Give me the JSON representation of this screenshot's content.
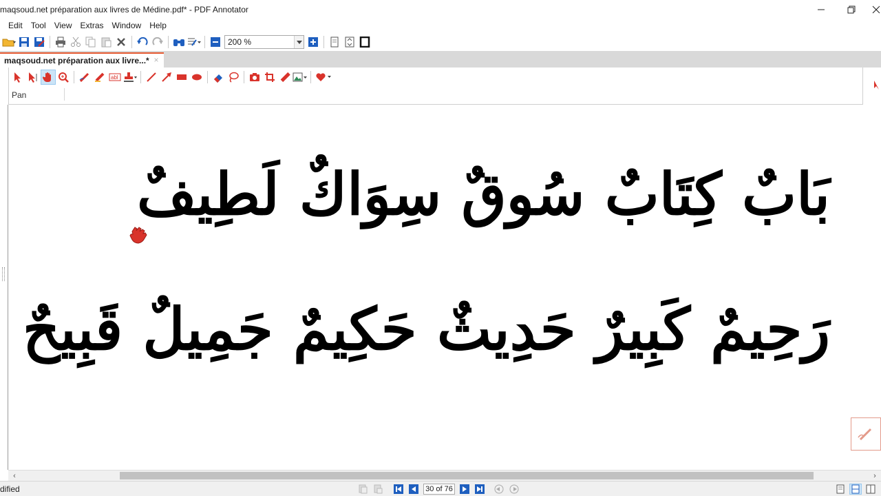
{
  "window": {
    "title": "maqsoud.net préparation aux livres de Médine.pdf* - PDF Annotator",
    "minimize_glyph": "—",
    "restore_glyph": "❐",
    "close_glyph": "✕"
  },
  "menu": {
    "items": [
      "Edit",
      "Tool",
      "View",
      "Extras",
      "Window",
      "Help"
    ]
  },
  "toolbar": {
    "icons": [
      "open-folder-icon",
      "save-icon",
      "save-as-icon",
      "print-icon",
      "cut-icon",
      "copy-icon",
      "paste-icon",
      "delete-icon",
      "undo-icon",
      "redo-icon",
      "find-icon",
      "page-layout-icon",
      "zoom-out-icon",
      "zoom-in-icon",
      "single-page-icon",
      "fit-page-icon",
      "fullscreen-icon"
    ],
    "zoom_value": "200 %"
  },
  "tabs": [
    {
      "label": "maqsoud.net préparation aux livre...*",
      "close": "×"
    }
  ],
  "annotation_toolbar": {
    "tools": [
      "select-icon",
      "select-text-icon",
      "pan-hand-icon",
      "zoom-magnifier-icon",
      "pen-icon",
      "highlighter-icon",
      "text-box-icon",
      "stamp-icon",
      "line-icon",
      "arrow-icon",
      "rectangle-icon",
      "ellipse-icon",
      "eraser-icon",
      "lasso-icon",
      "camera-icon",
      "crop-icon",
      "ruler-icon",
      "insert-image-icon",
      "favorites-heart-icon"
    ],
    "active_tool": "pan-hand-icon",
    "active_tool_label": "Pan"
  },
  "document": {
    "line1": "بَابٌ  كِتَابٌ  سُوقٌ سِوَاكٌ لَطِيفٌ",
    "line2": "رَحِيمٌ كَبِيرٌ حَدِيثٌ حَكِيمٌ جَمِيلٌ قَبِيحٌ"
  },
  "status": {
    "text": "dified",
    "page_indicator": "30 of 76"
  },
  "colors": {
    "accent": "#e4572e",
    "tool_red": "#d9332b",
    "nav_blue": "#1f5fbf"
  }
}
